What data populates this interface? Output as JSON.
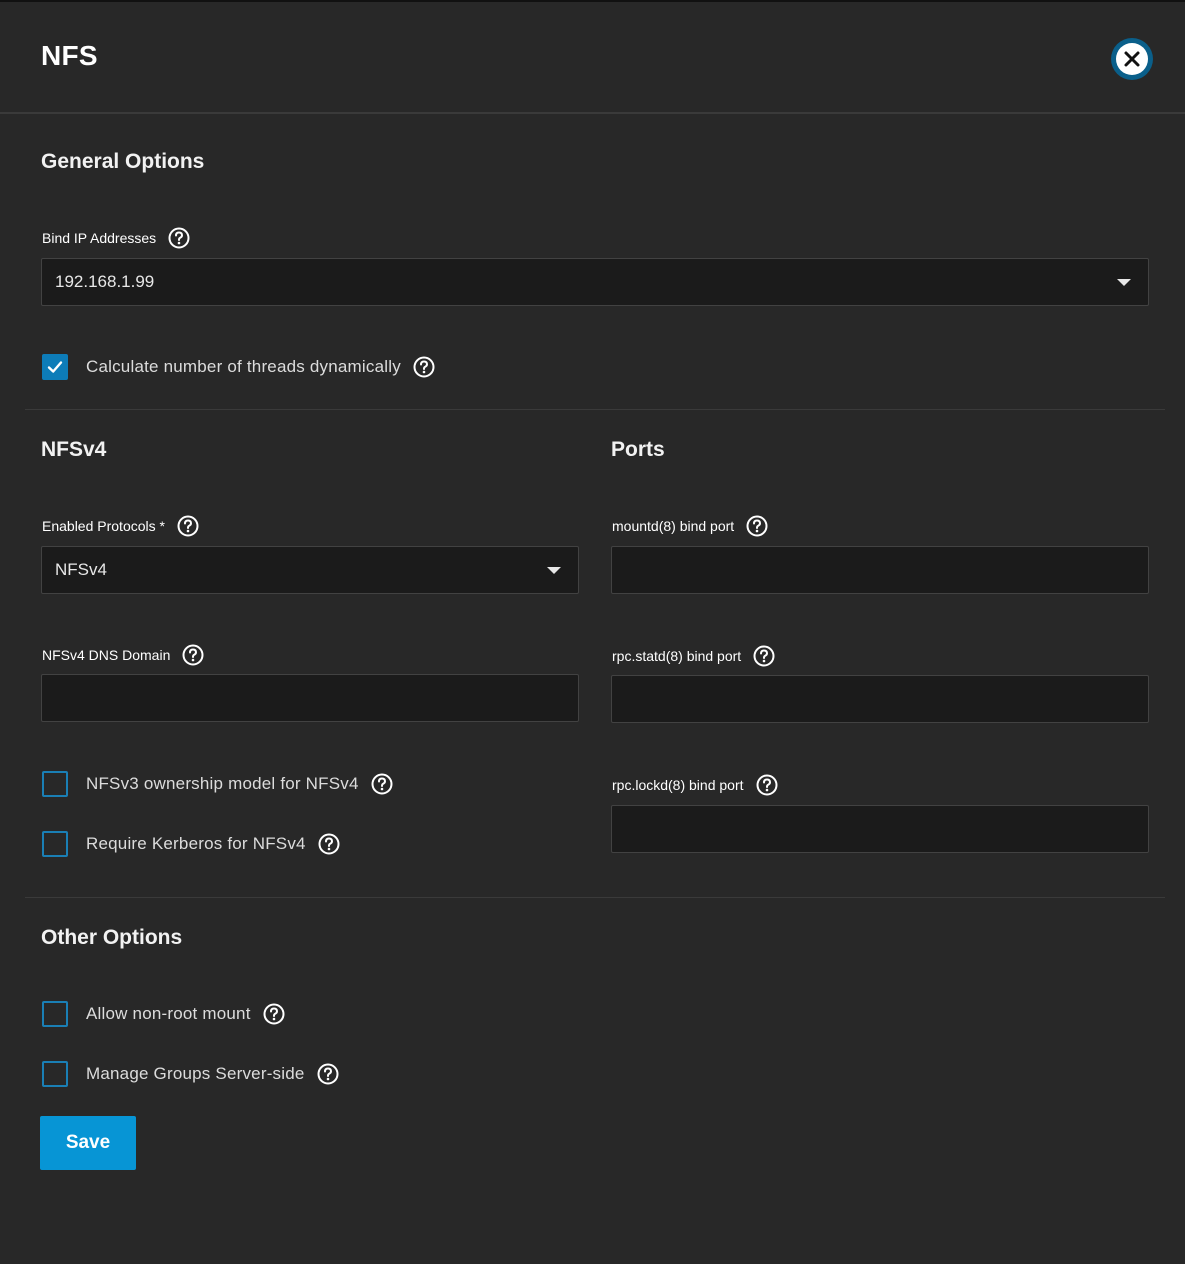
{
  "header": {
    "title": "NFS",
    "close_icon": "close-icon"
  },
  "general": {
    "title": "General Options",
    "bind_ip_label": "Bind IP Addresses",
    "bind_ip_value": "192.168.1.99",
    "threads_label": "Calculate number of threads dynamically",
    "threads_checked": true
  },
  "nfsv4": {
    "title": "NFSv4",
    "protocols_label": "Enabled Protocols *",
    "protocols_value": "NFSv4",
    "dns_domain_label": "NFSv4 DNS Domain",
    "dns_domain_value": "",
    "ownership_label": "NFSv3 ownership model for NFSv4",
    "ownership_checked": false,
    "kerberos_label": "Require Kerberos for NFSv4",
    "kerberos_checked": false
  },
  "ports": {
    "title": "Ports",
    "mountd_label": "mountd(8) bind port",
    "mountd_value": "",
    "statd_label": "rpc.statd(8) bind port",
    "statd_value": "",
    "lockd_label": "rpc.lockd(8) bind port",
    "lockd_value": ""
  },
  "other": {
    "title": "Other Options",
    "nonroot_label": "Allow non-root mount",
    "nonroot_checked": false,
    "groups_label": "Manage Groups Server-side",
    "groups_checked": false
  },
  "actions": {
    "save_label": "Save"
  },
  "colors": {
    "accent": "#0795d5",
    "background": "#282828",
    "input_bg": "#1b1b1b"
  }
}
